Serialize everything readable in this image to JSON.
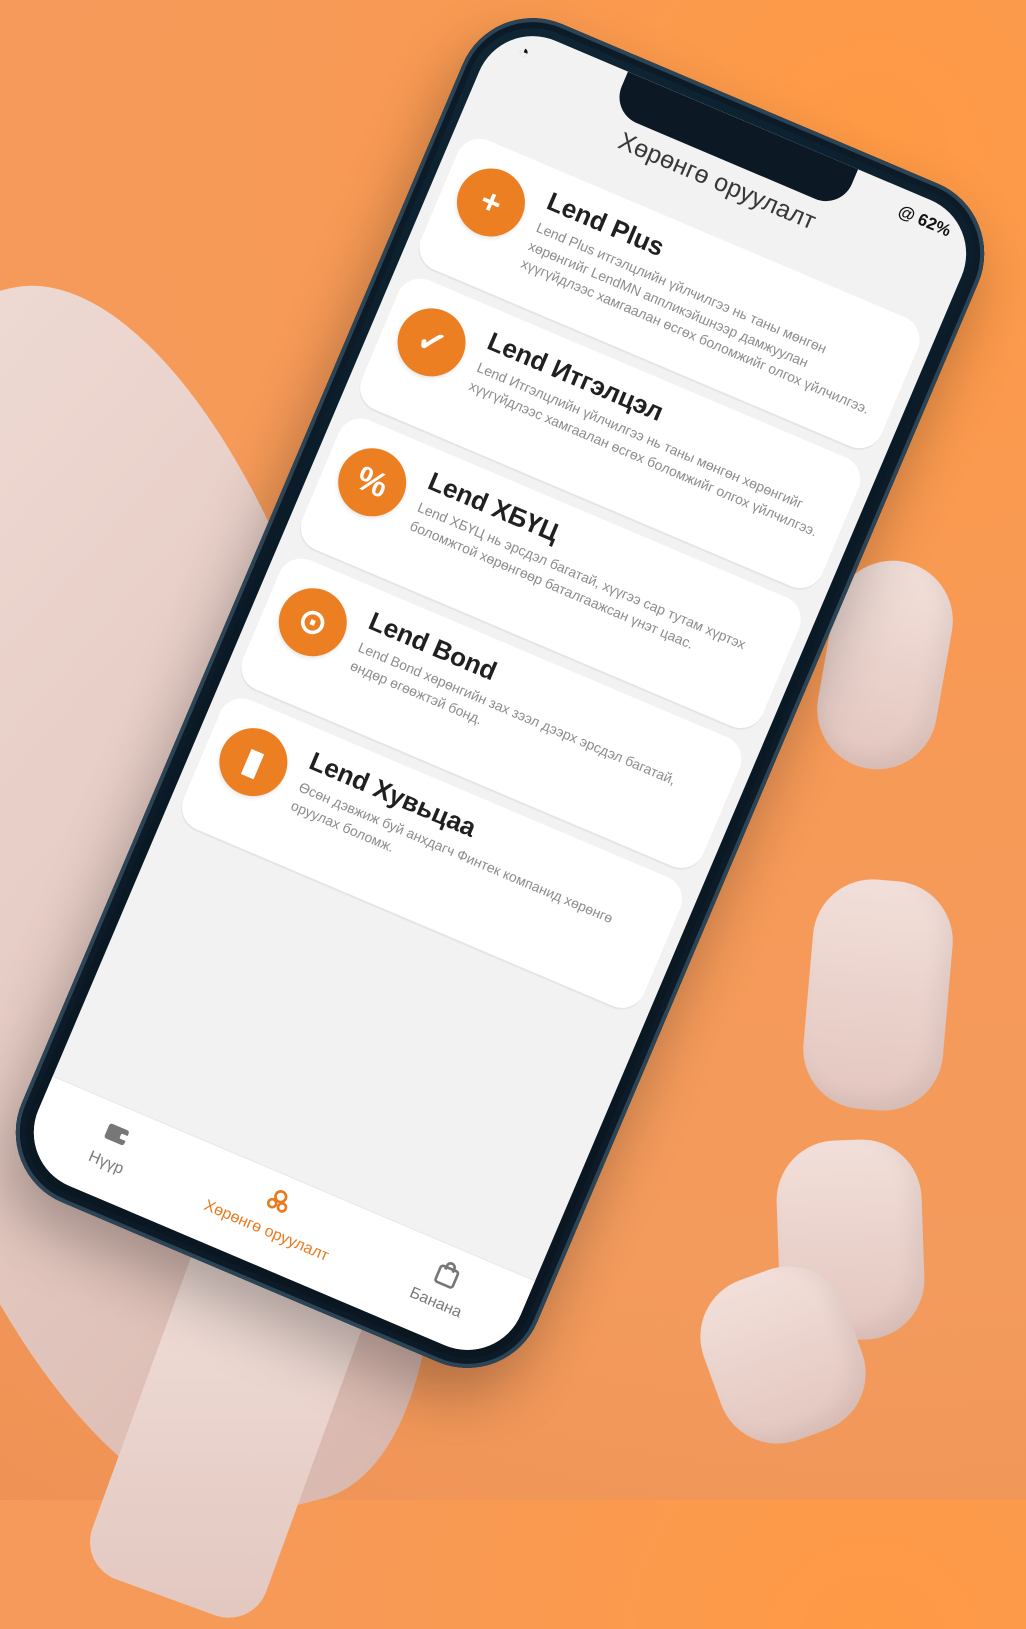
{
  "status": {
    "battery_text": "@ 62%"
  },
  "header": {
    "title": "Хөрөнгө оруулалт"
  },
  "cards": [
    {
      "title": "Lend Plus",
      "description": "Lend Plus итгэлцлийн үйлчилгээ нь таны мөнгөн хөрөнгийг LendMN аппликэйшнээр дамжуулан хүүгүйдлээс хамгаалан өсгөх боломжийг олгох үйлчилгээ.",
      "icon": "plus-icon"
    },
    {
      "title": "Lend Итгэлцэл",
      "description": "Lend Итгэлцлийн үйлчилгээ нь таны мөнгөн хөрөнгийг хүүгүйдлээс хамгаалан өсгөх боломжийг олгох үйлчилгээ.",
      "icon": "check-icon"
    },
    {
      "title": "Lend ХБҮЦ",
      "description": "Lend ХБҮЦ нь эрсдэл багатай, хүүгээ сар тутам хүртэх боломжтой хөрөнгөөр баталгаажсан үнэт цаас.",
      "icon": "percent-shield-icon"
    },
    {
      "title": "Lend Bond",
      "description": "Lend Bond хөрөнгийн зах зээл дээрх эрсдэл багатай, өндөр өгөөжтэй бонд.",
      "icon": "clock-check-icon"
    },
    {
      "title": "Lend Хувьцаа",
      "description": "Өсөн дэвжиж буй анхдагч Финтек компанид хөрөнгө оруулах боломж.",
      "icon": "signal-bars-icon"
    }
  ],
  "bottom_nav": {
    "home_label": "Нүүр",
    "invest_label": "Хөрөнгө оруулалт",
    "shop_label": "Банана"
  }
}
